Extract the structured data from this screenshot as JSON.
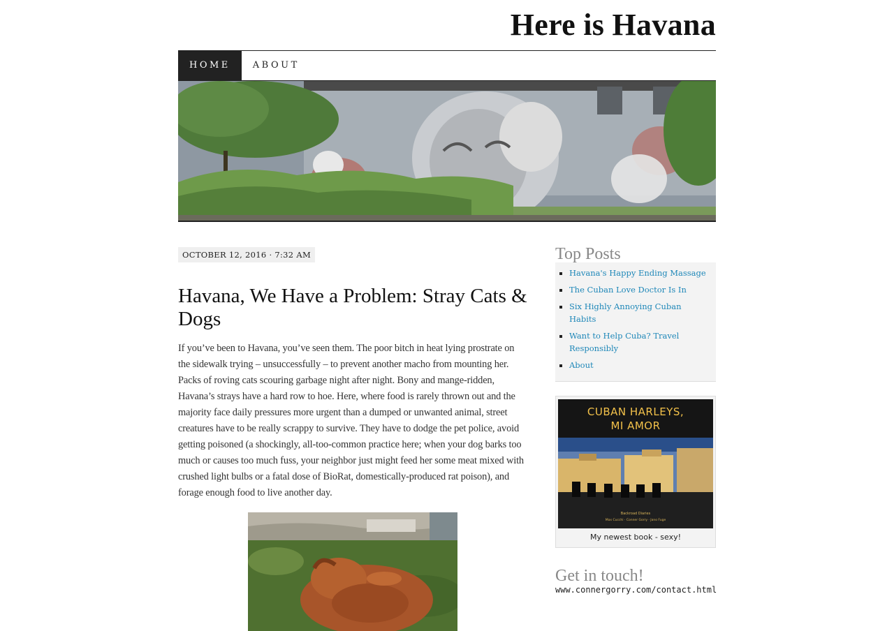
{
  "site": {
    "title": "Here is Havana"
  },
  "nav": {
    "items": [
      "Home",
      "About"
    ]
  },
  "post": {
    "date": "OCTOBER 12, 2016 · 7:32 AM",
    "title": "Havana, We Have a Problem: Stray Cats & Dogs",
    "body": "If you’ve been to Havana, you’ve seen them. The poor bitch in heat lying prostrate on the sidewalk trying – unsuccessfully – to prevent another macho from mounting her. Packs of roving cats scouring garbage night after night. Bony and mange-ridden, Havana’s strays have a hard row to hoe. Here, where food is rarely thrown out and the majority face daily pressures more urgent than a dumped or unwanted animal, street creatures have to be really scrappy to survive. They have to dodge the pet police, avoid getting poisoned (a shockingly, all-too-common practice here; when your dog barks too much or causes too much fuss, your neighbor just might feed her some meat mixed with crushed light bulbs or a fatal dose of BioRat, domestically-produced rat poison), and forage enough food to live another day."
  },
  "sidebar": {
    "top_posts_title": "Top Posts",
    "top_posts": [
      "Havana's Happy Ending Massage",
      "The Cuban Love Doctor Is In",
      "Six Highly Annoying Cuban Habits",
      "Want to Help Cuba? Travel Responsibly",
      "About"
    ],
    "book": {
      "cover_title_1": "CUBAN HARLEYS,",
      "cover_title_2": "MI AMOR",
      "cover_subtitle": "Backroad Diaries",
      "cover_authors": "Max Cucchi · Conner Gorry · Jano Fuge",
      "caption": "My newest book - sexy!"
    },
    "contact_title": "Get in touch!",
    "contact_url": "www.connergorry.com/contact.html"
  },
  "colors": {
    "link": "#1e87b8",
    "nav_active_bg": "#222222",
    "widget_title": "#888888"
  }
}
